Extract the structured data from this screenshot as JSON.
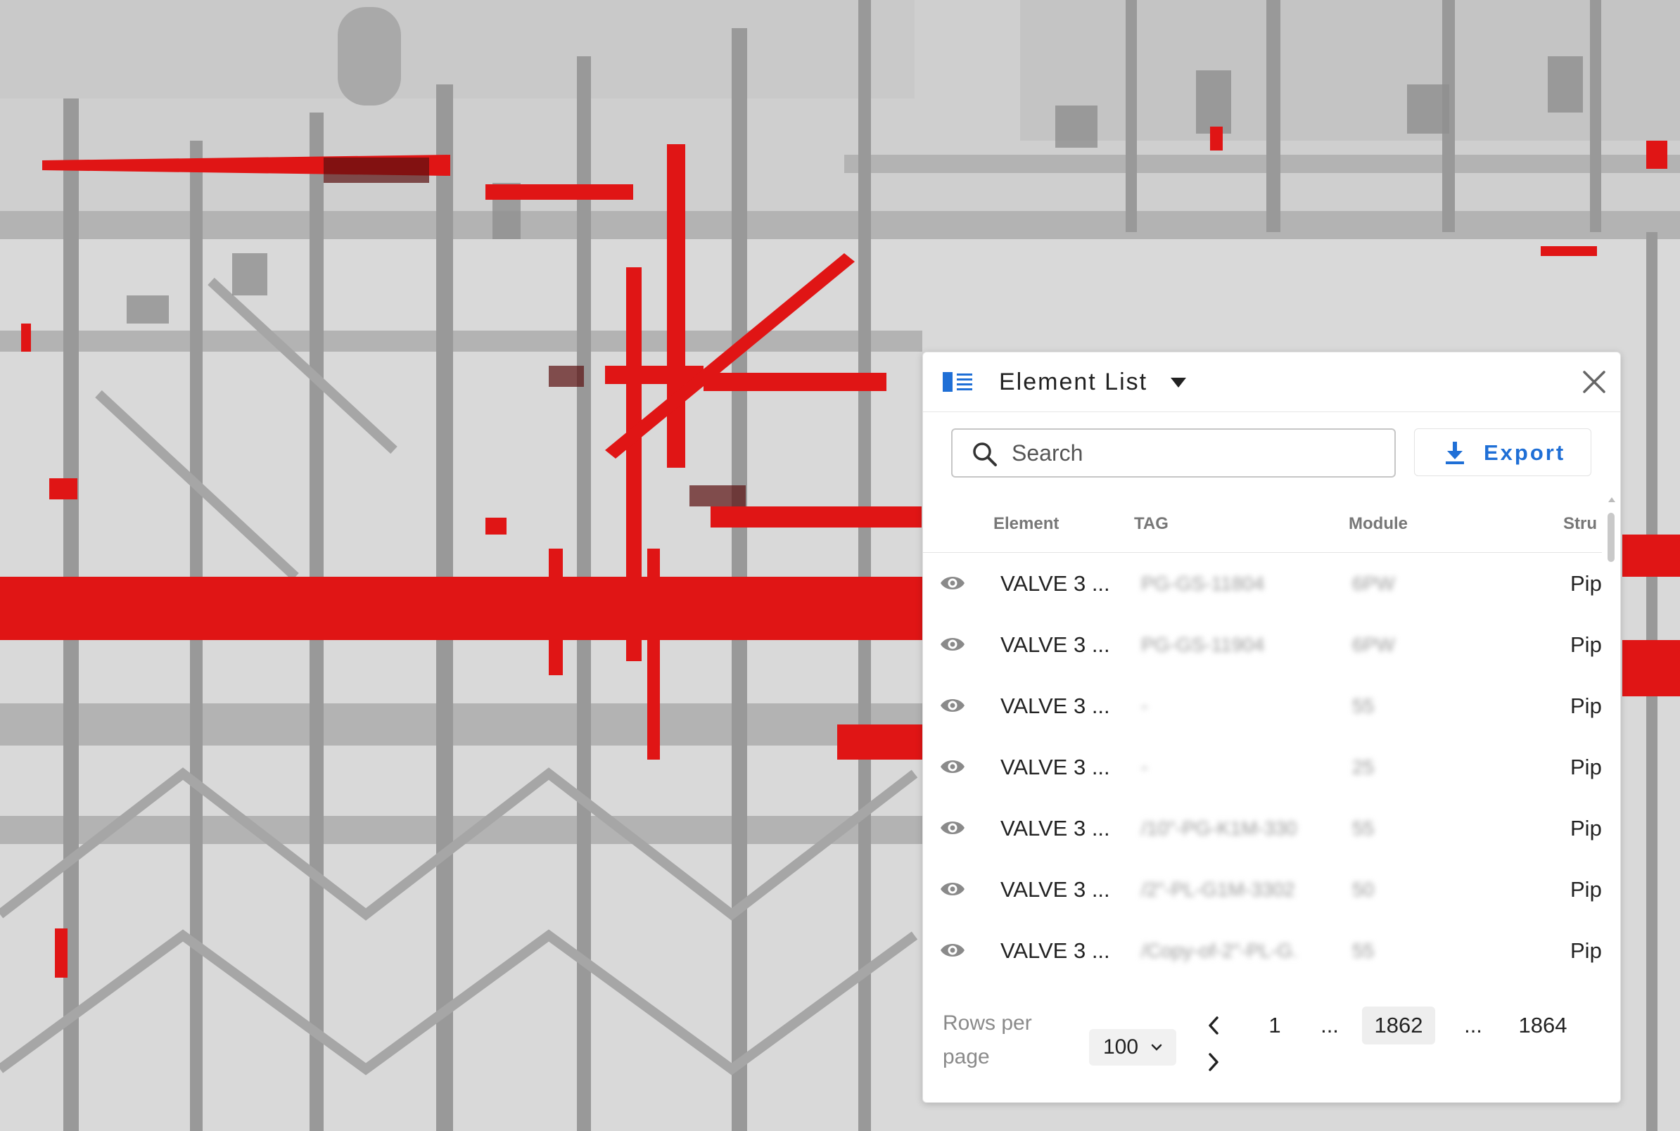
{
  "panel": {
    "title": "Element List",
    "search": {
      "placeholder": "Search",
      "value": ""
    },
    "export_label": "Export",
    "columns": [
      "Element",
      "TAG",
      "Module",
      "Stru"
    ],
    "rows": [
      {
        "element": "VALVE 3 ...",
        "tag": "PG-GS-11804",
        "module": "6PW",
        "structure": "Pip"
      },
      {
        "element": "VALVE 3 ...",
        "tag": "PG-GS-11904",
        "module": "6PW",
        "structure": "Pip"
      },
      {
        "element": "VALVE 3 ...",
        "tag": "-",
        "module": "55",
        "structure": "Pip"
      },
      {
        "element": "VALVE 3 ...",
        "tag": "-",
        "module": "25",
        "structure": "Pip"
      },
      {
        "element": "VALVE 3 ...",
        "tag": "/10\"-PG-K1M-330...",
        "module": "55",
        "structure": "Pip"
      },
      {
        "element": "VALVE 3 ...",
        "tag": "/2\"-PL-G1M-3302...",
        "module": "50",
        "structure": "Pip"
      },
      {
        "element": "VALVE 3 ...",
        "tag": "/Copy-of-2\"-PL-G...",
        "module": "55",
        "structure": "Pip"
      }
    ],
    "pagination": {
      "rows_per_page_label": "Rows per page",
      "rows_per_page_value": "100",
      "pages": [
        "1",
        "...",
        "1862",
        "...",
        "1864"
      ],
      "current_page": "1862"
    }
  },
  "colors": {
    "accent": "#1f6fd6",
    "highlight_red": "#e01515"
  }
}
